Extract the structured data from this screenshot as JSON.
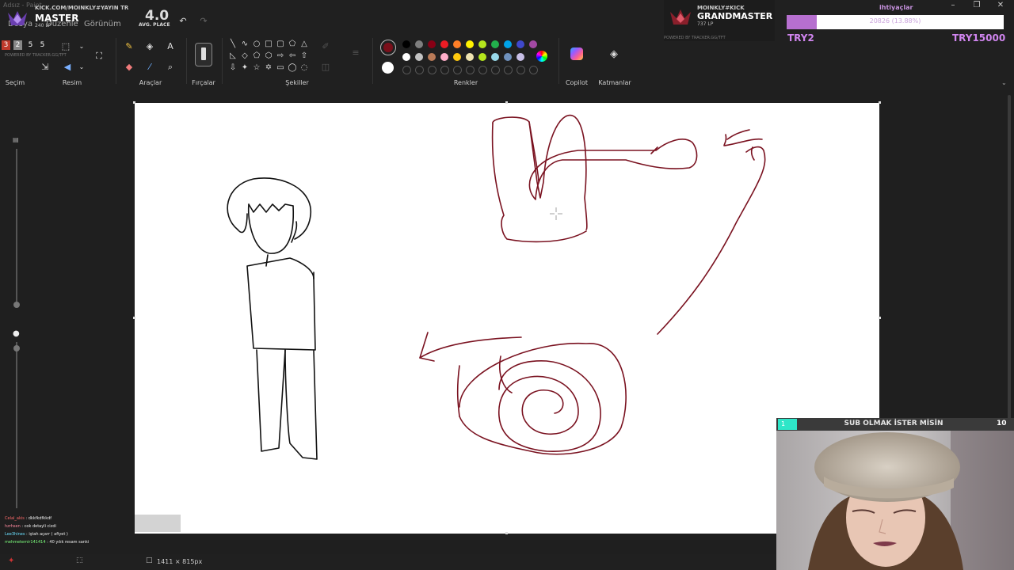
{
  "window": {
    "title": "Adsız - Paint"
  },
  "menu": {
    "file": "Dosya",
    "edit": "Düzenle",
    "view": "Görünüm"
  },
  "ribbon": {
    "groups": {
      "selection": "Seçim",
      "image": "Resim",
      "tools": "Araçlar",
      "brushes": "Fırçalar",
      "shapes": "Şekiller",
      "colors": "Renkler",
      "copilot": "Copilot",
      "layers": "Katmanlar"
    },
    "colors": {
      "primary": "#7a0f1a",
      "secondary": "#ffffff",
      "row1": [
        "#000000",
        "#7f7f7f",
        "#880015",
        "#ed1c24",
        "#ff7f27",
        "#fff200",
        "#b5e61d",
        "#22b14c",
        "#00a2e8",
        "#3f48cc",
        "#a349a4"
      ],
      "row2": [
        "#ffffff",
        "#c3c3c3",
        "#b97a57",
        "#ffaec9",
        "#ffc90e",
        "#efe4b0",
        "#b5e61d",
        "#99d9ea",
        "#7092be",
        "#c8bfe7"
      ]
    }
  },
  "overlay": {
    "left_rank": {
      "channel": "KICK.COM/MOINKLY#YAYIN TR",
      "rank": "MASTER",
      "lp": "240 LP",
      "powered": "POWERED BY TRACKER.GG/TFT",
      "counters": [
        "3",
        "2",
        "5",
        "5"
      ]
    },
    "avg_place": {
      "value": "4.0",
      "label": "AVG. PLACE"
    },
    "right_rank": {
      "channel": "MOINKLY#KICK",
      "rank": "GRANDMASTER",
      "lp": "737 LP",
      "powered": "POWERED BY TRACKER.GG/TFT"
    },
    "goal": {
      "title": "ihtiyaçlar",
      "progress_text": "20826 (13.88%)",
      "progress": 0.1388,
      "left": "TRY2",
      "right": "TRY15000"
    }
  },
  "chat": [
    {
      "user": "Celal_akis",
      "msg": "dkkfkdfkkdf",
      "color": "#ff6b6b"
    },
    {
      "user": "hzrhsen",
      "msg": "cok detayli cizdi",
      "color": "#ff8aa0"
    },
    {
      "user": "Lee3hines",
      "msg": "iştah açarr ( afiyet )",
      "color": "#6be0ff"
    },
    {
      "user": "mehmetemir141414",
      "msg": "40 yılık resam sanki",
      "color": "#7dff7d"
    }
  ],
  "status": {
    "canvas_size": "1411 × 815px"
  },
  "webcam": {
    "left_num": "1",
    "title": "SUB OLMAK İSTER MİSİN",
    "right_num": "10"
  }
}
